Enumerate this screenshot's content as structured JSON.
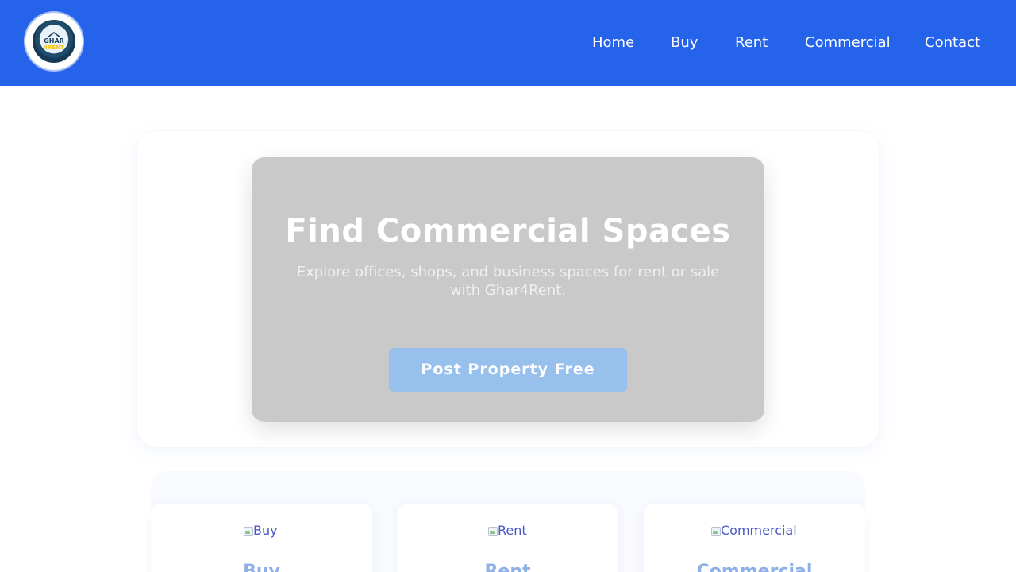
{
  "header": {
    "logo": {
      "line1": "GHAR",
      "line2": "4RENT"
    },
    "nav": [
      {
        "label": "Home"
      },
      {
        "label": "Buy"
      },
      {
        "label": "Rent"
      },
      {
        "label": "Commercial"
      },
      {
        "label": "Contact"
      }
    ]
  },
  "hero": {
    "title": "Find Commercial Spaces",
    "subtitle": "Explore offices, shops, and business spaces for rent or sale with Ghar4Rent.",
    "cta_label": "Post Property Free"
  },
  "categories": [
    {
      "image_alt": "Buy",
      "title": "Buy"
    },
    {
      "image_alt": "Rent",
      "title": "Rent"
    },
    {
      "image_alt": "Commercial",
      "title": "Commercial"
    }
  ],
  "colors": {
    "header_bg": "#2563eb",
    "hero_bg": "#c9c9c9",
    "cta_bg": "#97c0ec",
    "category_title": "#8fb0e6"
  },
  "icons": {
    "logo": "ghar4rent-logo-icon",
    "category_image": "broken-image-icon"
  }
}
